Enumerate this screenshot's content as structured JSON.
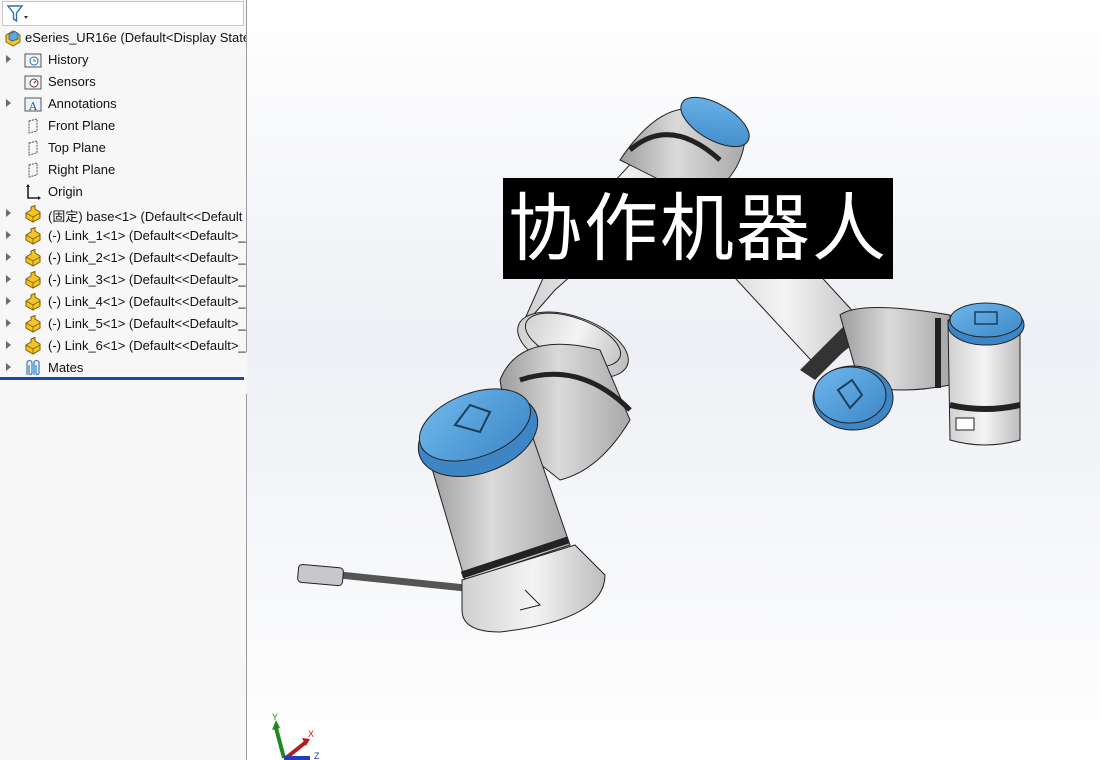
{
  "feature_tree": {
    "filter_icon": "filter-funnel-icon",
    "root": {
      "label": "eSeries_UR16e  (Default<Display State",
      "icon": "assembly-icon"
    },
    "items": [
      {
        "label": "History",
        "icon": "history-folder-icon",
        "expandable": true
      },
      {
        "label": "Sensors",
        "icon": "sensors-folder-icon",
        "expandable": false
      },
      {
        "label": "Annotations",
        "icon": "annotations-folder-icon",
        "expandable": true
      },
      {
        "label": "Front Plane",
        "icon": "plane-icon",
        "expandable": false
      },
      {
        "label": "Top Plane",
        "icon": "plane-icon",
        "expandable": false
      },
      {
        "label": "Right Plane",
        "icon": "plane-icon",
        "expandable": false
      },
      {
        "label": "Origin",
        "icon": "origin-icon",
        "expandable": false
      },
      {
        "label": "(固定) base<1> (Default<<Default",
        "icon": "part-icon",
        "expandable": true
      },
      {
        "label": "(-) Link_1<1> (Default<<Default>_",
        "icon": "part-icon",
        "expandable": true
      },
      {
        "label": "(-) Link_2<1> (Default<<Default>_",
        "icon": "part-icon",
        "expandable": true
      },
      {
        "label": "(-) Link_3<1> (Default<<Default>_",
        "icon": "part-icon",
        "expandable": true
      },
      {
        "label": "(-) Link_4<1> (Default<<Default>_",
        "icon": "part-icon",
        "expandable": true
      },
      {
        "label": "(-) Link_5<1> (Default<<Default>_",
        "icon": "part-icon",
        "expandable": true
      },
      {
        "label": "(-) Link_6<1> (Default<<Default>_",
        "icon": "part-icon",
        "expandable": true
      },
      {
        "label": "Mates",
        "icon": "mates-icon",
        "expandable": true
      }
    ]
  },
  "viewport": {
    "overlay_title": "协作机器人",
    "model": "collaborative-robot-arm",
    "colors": {
      "cap_blue": "#4a9ad8",
      "body_gray": "#c4c4c4",
      "ring_dark": "#2a2a2a",
      "overlay_bg": "#000000",
      "overlay_text": "#ffffff"
    },
    "triad": {
      "x_label": "X",
      "y_label": "Y",
      "z_label": "Z"
    }
  }
}
